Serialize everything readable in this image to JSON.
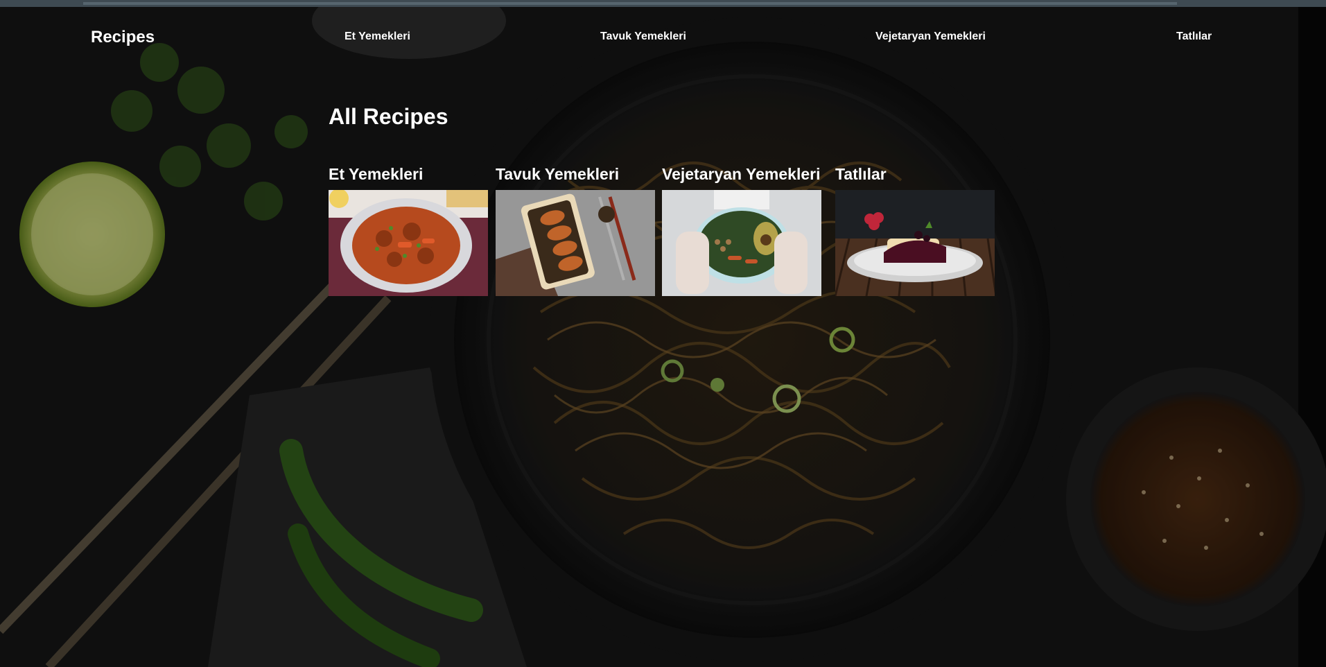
{
  "colors": {
    "background": "#0b0b0b",
    "text": "#ffffff",
    "topbar": "#3e4a52"
  },
  "nav": {
    "brand": "Recipes",
    "links": [
      "Et Yemekleri",
      "Tavuk Yemekleri",
      "Vejetaryan Yemekleri",
      "Tatlılar"
    ]
  },
  "main": {
    "title": "All Recipes",
    "cards": [
      {
        "title": "Et Yemekleri",
        "image": "meat-stew-photo"
      },
      {
        "title": "Tavuk Yemekleri",
        "image": "roast-chicken-photo"
      },
      {
        "title": "Vejetaryan Yemekleri",
        "image": "vegetarian-bowl-photo"
      },
      {
        "title": "Tatlılar",
        "image": "dessert-cake-photo"
      }
    ]
  },
  "background_image": "noodles-bowl-photo"
}
